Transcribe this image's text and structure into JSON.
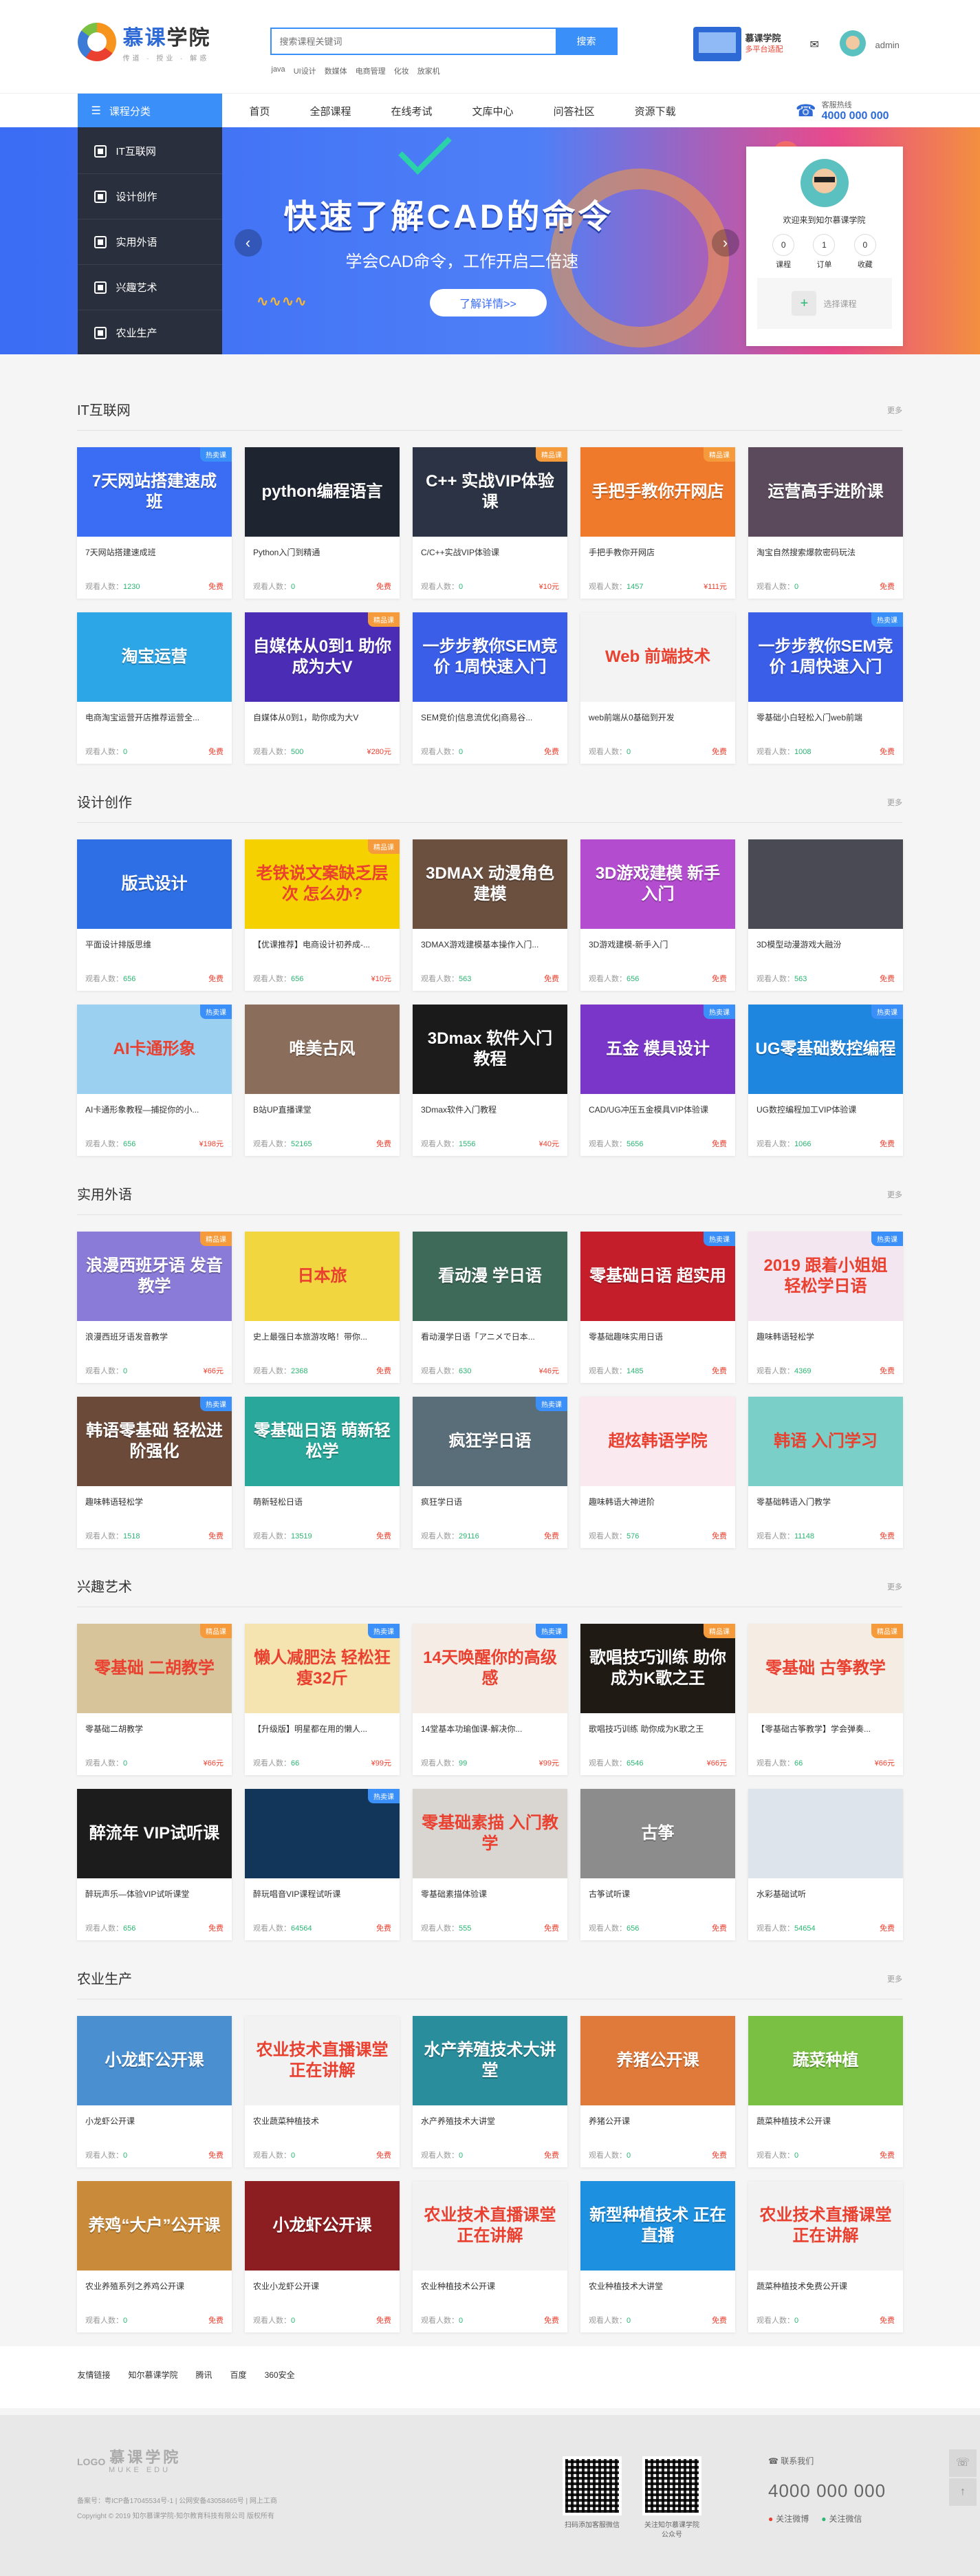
{
  "header": {
    "logo_name_a": "慕课",
    "logo_name_b": "学院",
    "logo_slogan": "传道 · 授业 · 解惑",
    "search_placeholder": "搜索课程关键词",
    "search_button": "搜索",
    "hot_keywords": [
      "java",
      "UI设计",
      "数媒体",
      "电商管理",
      "化妆",
      "放家机"
    ],
    "app_title": "慕课学院",
    "app_sub": "多平台适配",
    "mail_icon": "mail-icon",
    "username": "admin"
  },
  "nav": {
    "category_label": "课程分类",
    "menu": [
      "首页",
      "全部课程",
      "在线考试",
      "文库中心",
      "问答社区",
      "资源下载"
    ],
    "hotline_label": "客服热线",
    "hotline_number": "4000 000 000"
  },
  "banner": {
    "categories": [
      "IT互联网",
      "设计创作",
      "实用外语",
      "兴趣艺术",
      "农业生产"
    ],
    "title": "快速了解CAD的命令",
    "subtitle": "学会CAD命令，工作开启二倍速",
    "button": "了解详情>>",
    "prev": "‹",
    "next": "›"
  },
  "user_card": {
    "welcome": "欢迎来到知尔慕课学院",
    "stats": [
      {
        "value": "0",
        "label": "课程"
      },
      {
        "value": "1",
        "label": "订单"
      },
      {
        "value": "0",
        "label": "收藏"
      }
    ],
    "select_label": "选择课程"
  },
  "colors": {
    "accent": "#3a8ff8",
    "free": "#e9402f",
    "count": "#2bb673",
    "badge_hot": "#3a8ff8",
    "badge_boutique": "#f59b3b"
  },
  "sections": [
    {
      "title": "IT互联网",
      "more": "更多",
      "courses": [
        {
          "thumb": "7天网站搭建速成班",
          "bg": "#3a6cf4",
          "badge": "热卖课",
          "title": "7天网站搭建速成班",
          "count": "1230",
          "price": "免费"
        },
        {
          "thumb": "python编程语言",
          "bg": "#1e2430",
          "badge": "",
          "title": "Python入门到精通",
          "count": "0",
          "price": "免费"
        },
        {
          "thumb": "C++ 实战VIP体验课",
          "bg": "#2b3344",
          "badge": "精品课",
          "title": "C/C++实战VIP体验课",
          "count": "0",
          "price": "¥10元"
        },
        {
          "thumb": "手把手教你开网店",
          "bg": "#f07a2c",
          "badge": "精品课",
          "title": "手把手教你开网店",
          "count": "1457",
          "price": "¥111元"
        },
        {
          "thumb": "运营高手进阶课",
          "bg": "#5a4a5c",
          "badge": "",
          "title": "淘宝自然搜索爆款密码玩法",
          "count": "0",
          "price": "免费"
        },
        {
          "thumb": "淘宝运营",
          "bg": "#2da6e8",
          "badge": "",
          "title": "电商淘宝运营开店推荐运营全...",
          "count": "0",
          "price": "免费"
        },
        {
          "thumb": "自媒体从0到1 助你成为大V",
          "bg": "#4b2db5",
          "badge": "精品课",
          "title": "自媒体从0到1，助你成为大V",
          "count": "500",
          "price": "¥280元"
        },
        {
          "thumb": "一步步教你SEM竞价 1周快速入门",
          "bg": "#3a5ee8",
          "badge": "",
          "title": "SEM竞价|信息流优化|商易谷...",
          "count": "0",
          "price": "免费"
        },
        {
          "thumb": "Web 前端技术",
          "bg": "#f3f3f3",
          "badge": "",
          "title": "web前端从0基础到开发",
          "count": "0",
          "price": "免费"
        },
        {
          "thumb": "一步步教你SEM竞价 1周快速入门",
          "bg": "#3a5ee8",
          "badge": "热卖课",
          "title": "零基础小白轻松入门web前端",
          "count": "1008",
          "price": "免费"
        }
      ]
    },
    {
      "title": "设计创作",
      "more": "更多",
      "courses": [
        {
          "thumb": "版式设计",
          "bg": "#2e6fe6",
          "badge": "",
          "title": "平面设计排版思维",
          "count": "656",
          "price": "免费"
        },
        {
          "thumb": "老铁说文案缺乏层次 怎么办?",
          "bg": "#f5d100",
          "badge": "精品课",
          "title": "【优课推荐】电商设计初养成-...",
          "count": "656",
          "price": "¥10元"
        },
        {
          "thumb": "3DMAX 动漫角色建模",
          "bg": "#6b5040",
          "badge": "",
          "title": "3DMAX游戏建模基本操作入门...",
          "count": "563",
          "price": "免费"
        },
        {
          "thumb": "3D游戏建模 新手入门",
          "bg": "#b34ccf",
          "badge": "",
          "title": "3D游戏建模-新手入门",
          "count": "656",
          "price": "免费"
        },
        {
          "thumb": "",
          "bg": "#4a4a55",
          "badge": "",
          "title": "3D模型动漫游戏大融汾",
          "count": "563",
          "price": "免费"
        },
        {
          "thumb": "AI卡通形象",
          "bg": "#9bd0f0",
          "badge": "热卖课",
          "title": "AI卡通形象教程—捕捉你的小...",
          "count": "656",
          "price": "¥198元"
        },
        {
          "thumb": "唯美古风",
          "bg": "#8a6d5a",
          "badge": "",
          "title": "B站UP直播课堂",
          "count": "52165",
          "price": "免费"
        },
        {
          "thumb": "3Dmax 软件入门教程",
          "bg": "#1a1a1a",
          "badge": "",
          "title": "3Dmax软件入门教程",
          "count": "1556",
          "price": "¥40元"
        },
        {
          "thumb": "五金 模具设计",
          "bg": "#7a35c9",
          "badge": "热卖课",
          "title": "CAD/UG冲压五金模具VIP体验课",
          "count": "5656",
          "price": "免费"
        },
        {
          "thumb": "UG零基础数控编程",
          "bg": "#1f86e0",
          "badge": "热卖课",
          "title": "UG数控编程加工VIP体验课",
          "count": "1066",
          "price": "免费"
        }
      ]
    },
    {
      "title": "实用外语",
      "more": "更多",
      "courses": [
        {
          "thumb": "浪漫西班牙语 发音教学",
          "bg": "#8a7bd8",
          "badge": "精品课",
          "title": "浪漫西班牙语发音教学",
          "count": "0",
          "price": "¥66元"
        },
        {
          "thumb": "日本旅",
          "bg": "#f2d640",
          "badge": "",
          "title": "史上最强日本旅游攻略！带你...",
          "count": "2368",
          "price": "免费"
        },
        {
          "thumb": "看动漫 学日语",
          "bg": "#3e6a5a",
          "badge": "",
          "title": "看动漫学日语「アニメで日本...",
          "count": "630",
          "price": "¥46元"
        },
        {
          "thumb": "零基础日语 超实用",
          "bg": "#c41e2a",
          "badge": "热卖课",
          "title": "零基础趣味实用日语",
          "count": "1485",
          "price": "免费"
        },
        {
          "thumb": "2019 跟着小姐姐 轻松学日语",
          "bg": "#f4e6f0",
          "badge": "热卖课",
          "title": "趣味韩语轻松学",
          "count": "4369",
          "price": "免费"
        },
        {
          "thumb": "韩语零基础 轻松进阶强化",
          "bg": "#6b4a3a",
          "badge": "热卖课",
          "title": "趣味韩语轻松学",
          "count": "1518",
          "price": "免费"
        },
        {
          "thumb": "零基础日语 萌新轻松学",
          "bg": "#29a79a",
          "badge": "",
          "title": "萌新轻松日语",
          "count": "13519",
          "price": "免费"
        },
        {
          "thumb": "疯狂学日语",
          "bg": "#5a6e7a",
          "badge": "热卖课",
          "title": "疯狂学日语",
          "count": "29116",
          "price": "免费"
        },
        {
          "thumb": "超炫韩语学院",
          "bg": "#fbe9f0",
          "badge": "",
          "title": "趣味韩语大神进阶",
          "count": "576",
          "price": "免费"
        },
        {
          "thumb": "韩语 入门学习",
          "bg": "#7ad0c8",
          "badge": "",
          "title": "零基础韩语入门教学",
          "count": "11148",
          "price": "免费"
        }
      ]
    },
    {
      "title": "兴趣艺术",
      "more": "更多",
      "courses": [
        {
          "thumb": "零基础 二胡教学",
          "bg": "#d8c49a",
          "badge": "精品课",
          "title": "零基础二胡教学",
          "count": "0",
          "price": "¥66元"
        },
        {
          "thumb": "懒人减肥法 轻松狂瘦32斤",
          "bg": "#f5e3b0",
          "badge": "热卖课",
          "title": "【升级版】明星都在用的懒人...",
          "count": "66",
          "price": "¥99元"
        },
        {
          "thumb": "14天唤醒你的高级感",
          "bg": "#f6ece6",
          "badge": "热卖课",
          "title": "14堂基本功瑜伽课-解决你...",
          "count": "99",
          "price": "¥99元"
        },
        {
          "thumb": "歌唱技巧训练 助你成为K歌之王",
          "bg": "#1f1a14",
          "badge": "精品课",
          "title": "歌唱技巧训练 助你成为K歌之王",
          "count": "6546",
          "price": "¥66元"
        },
        {
          "thumb": "零基础 古筝教学",
          "bg": "#f5ece4",
          "badge": "精品课",
          "title": "【零基础古筝教学】学会弹奏...",
          "count": "66",
          "price": "¥66元"
        },
        {
          "thumb": "醉流年 VIP试听课",
          "bg": "#1c1c1c",
          "badge": "",
          "title": "醉玩声乐—体验VIP试听课堂",
          "count": "656",
          "price": "免费"
        },
        {
          "thumb": "",
          "bg": "#12365a",
          "badge": "热卖课",
          "title": "醉玩唱音VIP课程试听课",
          "count": "64564",
          "price": "免费"
        },
        {
          "thumb": "零基础素描 入门教学",
          "bg": "#d9d6d2",
          "badge": "",
          "title": "零基础素描体验课",
          "count": "555",
          "price": "免费"
        },
        {
          "thumb": "古筝",
          "bg": "#8c8c8c",
          "badge": "",
          "title": "古筝试听课",
          "count": "656",
          "price": "免费"
        },
        {
          "thumb": "",
          "bg": "#dde4ec",
          "badge": "",
          "title": "水彩基础试听",
          "count": "54654",
          "price": "免费"
        }
      ]
    },
    {
      "title": "农业生产",
      "more": "更多",
      "courses": [
        {
          "thumb": "小龙虾公开课",
          "bg": "#4a8fd0",
          "badge": "",
          "title": "小龙虾公开课",
          "count": "0",
          "price": "免费"
        },
        {
          "thumb": "农业技术直播课堂 正在讲解",
          "bg": "#f2f2f2",
          "badge": "",
          "title": "农业蔬菜种植技术",
          "count": "0",
          "price": "免费"
        },
        {
          "thumb": "水产养殖技术大讲堂",
          "bg": "#2a8d9c",
          "badge": "",
          "title": "水产养殖技术大讲堂",
          "count": "0",
          "price": "免费"
        },
        {
          "thumb": "养猪公开课",
          "bg": "#e07a3a",
          "badge": "",
          "title": "养猪公开课",
          "count": "0",
          "price": "免费"
        },
        {
          "thumb": "蔬菜种植",
          "bg": "#7ac143",
          "badge": "",
          "title": "蔬菜种植技术公开课",
          "count": "0",
          "price": "免费"
        },
        {
          "thumb": "养鸡“大户”公开课",
          "bg": "#c98a3a",
          "badge": "",
          "title": "农业养殖系列之养鸡公开课",
          "count": "0",
          "price": "免费"
        },
        {
          "thumb": "小龙虾公开课",
          "bg": "#8c1e22",
          "badge": "",
          "title": "农业小龙虾公开课",
          "count": "0",
          "price": "免费"
        },
        {
          "thumb": "农业技术直播课堂 正在讲解",
          "bg": "#f2f2f2",
          "badge": "",
          "title": "农业种植技术公开课",
          "count": "0",
          "price": "免费"
        },
        {
          "thumb": "新型种植技术 正在直播",
          "bg": "#1e90e0",
          "badge": "",
          "title": "农业种植技术大讲堂",
          "count": "0",
          "price": "免费"
        },
        {
          "thumb": "农业技术直播课堂 正在讲解",
          "bg": "#f2f2f2",
          "badge": "",
          "title": "蔬菜种植技术免费公开课",
          "count": "0",
          "price": "免费"
        }
      ]
    }
  ],
  "common": {
    "count_label": "观看人数：",
    "more": "更多"
  },
  "links": {
    "label": "友情链接",
    "items": [
      "知尔慕课学院",
      "腾讯",
      "百度",
      "360安全"
    ]
  },
  "footer": {
    "logo": "LOGO",
    "name": "慕课学院",
    "name_en": "MUKE EDU",
    "info1": "备案号：粤ICP备17045534号-1 | 公网安备43058465号 | 网上工商",
    "info2": "Copyright © 2019 知尔慕课学院-知尔教育科技有限公司 版权所有",
    "qr1_label": "扫码添加客服微信",
    "qr2_label": "关注知尔慕课学院公众号",
    "contact_label": "联系我们",
    "contact_phone": "4000 000 000",
    "follow_weibo": "关注微博",
    "follow_wechat": "关注微信"
  }
}
